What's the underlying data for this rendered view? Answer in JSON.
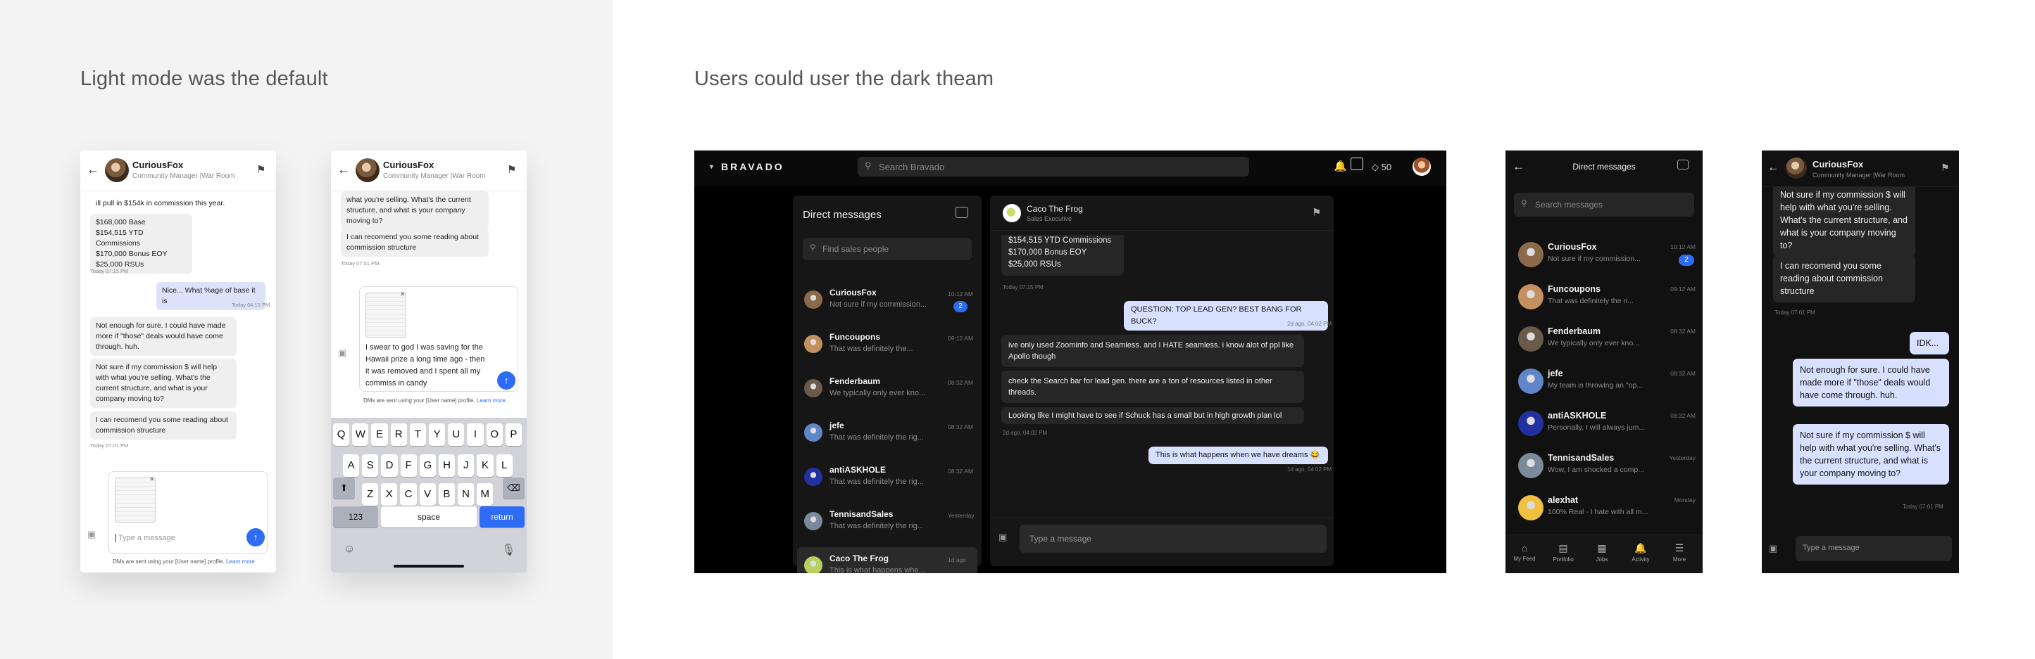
{
  "headings": {
    "left": "Light mode was the default",
    "right": "Users could user the dark theam"
  },
  "colors": {
    "accent": "#2f6cf6",
    "myBubble": "#dde2fb",
    "darkBg": "#000000"
  },
  "contact": {
    "name": "CuriousFox",
    "sub": "Community Manager |War Room"
  },
  "l1": {
    "m0": "ill pull in $154k in commission this year.",
    "m1": [
      "$168,000 Base",
      "$154,515 YTD Commissions",
      "$170,000 Bonus EOY",
      "$25,000 RSUs"
    ],
    "t1": "Today 07:15 PM",
    "m2": "Nice... What %age of base it is",
    "t2": "Today 04:15 PM",
    "m3": "Not enough for sure. I could have made more if \"those\" deals would have come through. huh.",
    "m4": "Not sure if my commission $ will help with what you're selling. What's the current structure, and what is your company moving to?",
    "m5": "I can recomend you some reading about commission structure",
    "t3": "Today 07:01 PM",
    "placeholder": "Type a message",
    "disclaimer": "DMs are sent using your [User name] profile.",
    "learn": "Learn more"
  },
  "l2": {
    "m0": "what you're selling. What's the current structure, and what is your company moving to?",
    "m1": "I can recomend you some reading about commission structure",
    "t1": "Today 07:01 PM",
    "draft": "I swear to god I was saving for the Hawaii prize a long time ago - then it was removed and I spent all my commiss in candy",
    "disclaimer": "DMs are sent using your [User name] profile.",
    "learn": "Learn more",
    "keys": {
      "row1": [
        "Q",
        "W",
        "E",
        "R",
        "T",
        "Y",
        "U",
        "I",
        "O",
        "P"
      ],
      "row2": [
        "A",
        "S",
        "D",
        "F",
        "G",
        "H",
        "J",
        "K",
        "L"
      ],
      "row3": [
        "Z",
        "X",
        "C",
        "V",
        "B",
        "N",
        "M"
      ],
      "num": "123",
      "space": "space",
      "ret": "return"
    }
  },
  "desktop": {
    "brand": "BRAVADO",
    "search": "Search Bravado",
    "points": "50",
    "dmTitle": "Direct messages",
    "findPlaceholder": "Find sales people",
    "list": [
      {
        "name": "CuriousFox",
        "prev": "Not sure if my commission...",
        "time": "10:12 AM",
        "badge": "2"
      },
      {
        "name": "Funcoupons",
        "prev": "That was definitely the...",
        "time": "09:12 AM"
      },
      {
        "name": "Fenderbaum",
        "prev": "We typically only ever kno...",
        "time": "08:32 AM"
      },
      {
        "name": "jefe",
        "prev": "That was definitely the rig...",
        "time": "08:32 AM"
      },
      {
        "name": "antiASKHOLE",
        "prev": "That was definitely the rig...",
        "time": "08:32 AM"
      },
      {
        "name": "TennisandSales",
        "prev": "That was definitely the rig...",
        "time": "Yesterday"
      },
      {
        "name": "Caco The Frog",
        "prev": "This is what happens whe...",
        "time": "1d ago"
      }
    ],
    "chat": {
      "name": "Caco The Frog",
      "sub": "Sales Executive",
      "m0": [
        "$154,515 YTD Commissions",
        "$170,000 Bonus EOY",
        "$25,000 RSUs"
      ],
      "t0": "Today 07:15 PM",
      "m1": "QUESTION: TOP LEAD GEN? BEST BANG FOR BUCK?",
      "t1": "2d ago, 04:02 PM",
      "m2": "ive only used Zoominfo and Seamless. and I HATE seamless. i know alot of ppl like Apollo though",
      "m3": "check the Search bar for lead gen. there are a ton of resources listed in other threads.",
      "m4": "Looking like I might have to see if Schuck has a small but in high growth plan lol",
      "t2": "2d ago, 04:02 PM",
      "m5": "This is what happens when we have dreams 😂",
      "t3": "1d ago, 04:02 PM",
      "placeholder": "Type a message"
    }
  },
  "mobileDark": {
    "title": "Direct messages",
    "search": "Search messages",
    "list": [
      {
        "name": "CuriousFox",
        "prev": "Not sure if my commission...",
        "time": "10:12 AM",
        "badge": "2"
      },
      {
        "name": "Funcoupons",
        "prev": "That was definitely the ri...",
        "time": "09:12 AM"
      },
      {
        "name": "Fenderbaum",
        "prev": "We typically only ever kno...",
        "time": "08:32 AM"
      },
      {
        "name": "jefe",
        "prev": "My team is throwing an \"op...",
        "time": "08:32 AM"
      },
      {
        "name": "antiASKHOLE",
        "prev": "Personally, I will always jum...",
        "time": "08:32 AM"
      },
      {
        "name": "TennisandSales",
        "prev": "Wow, I am shocked a comp...",
        "time": "Yesterday"
      },
      {
        "name": "alexhat",
        "prev": "100% Real - I hate with all m...",
        "time": "Monday"
      }
    ],
    "tabs": [
      "My Feed",
      "Portfolio",
      "Jobs",
      "Activity",
      "More"
    ]
  },
  "chatDark": {
    "m0": "Not sure if my commission $ will help with what you're selling. What's the current structure, and what is your company moving to?",
    "m1": "I can recomend you some reading about commission structure",
    "t1": "Today 07:01 PM",
    "m2": "IDK...",
    "m3": "Not enough for sure. I could have made more if \"those\" deals would have come through. huh.",
    "m4": "Not sure if my commission $ will help with what you're selling. What's the current structure, and what is your company moving to?",
    "t2": "Today 07:01 PM",
    "placeholder": "Type a message"
  }
}
